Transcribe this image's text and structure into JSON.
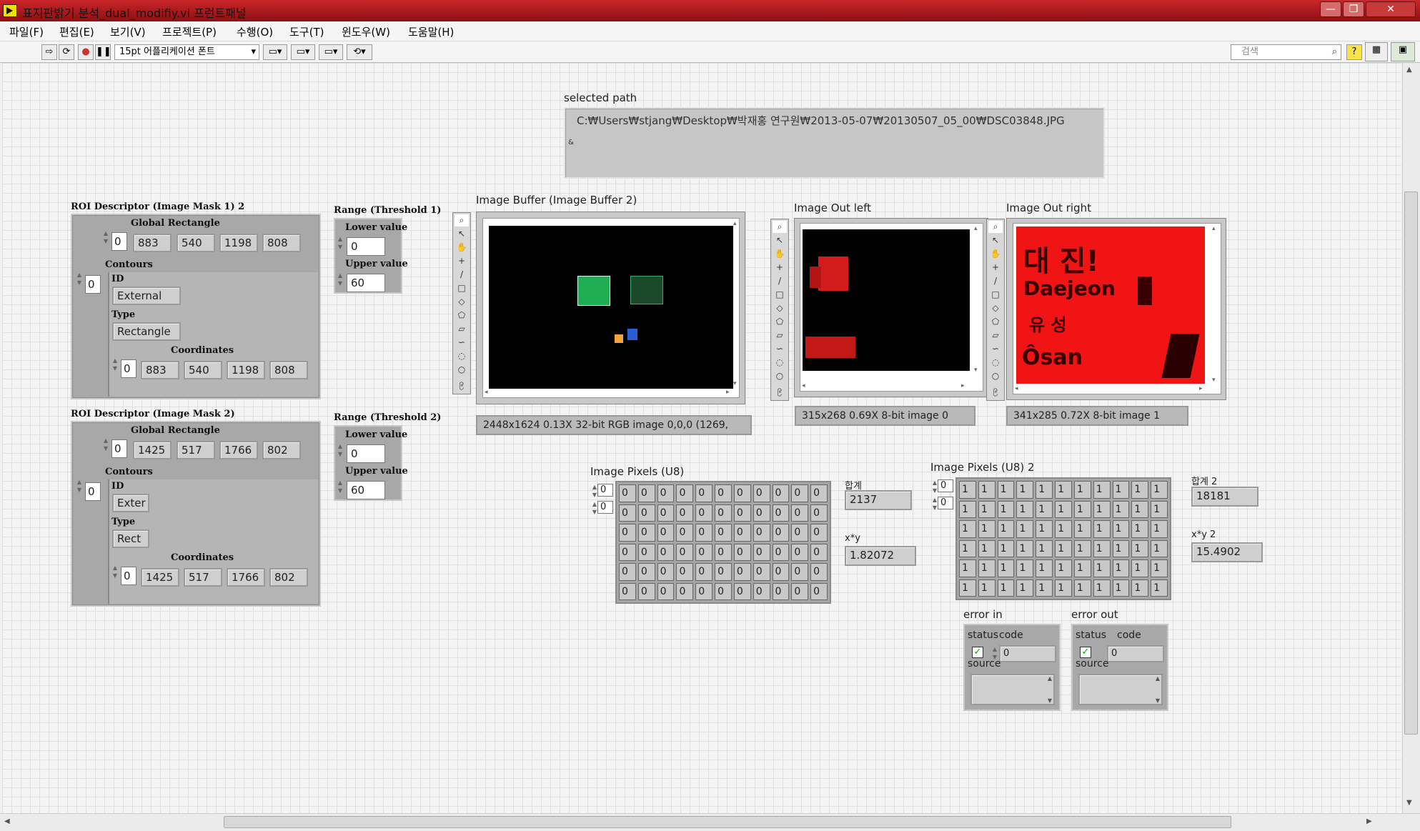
{
  "window": {
    "title": "표지판밝기 분석_dual_modifiy.vi 프런트패널"
  },
  "menu": [
    "파일(F)",
    "편집(E)",
    "보기(V)",
    "프로젝트(P)",
    "수행(O)",
    "도구(T)",
    "윈도우(W)",
    "도움말(H)"
  ],
  "toolbar": {
    "font": "15pt 어플리케이션 폰트",
    "search_placeholder": "검색"
  },
  "path": {
    "label": "selected path",
    "value": "C:₩Users₩stjang₩Desktop₩박재홍 연구원₩2013-05-07₩20130507_05_00₩DSC03848.JPG"
  },
  "roi1": {
    "label": "ROI Descriptor (Image Mask 1) 2",
    "global_label": "Global Rectangle",
    "gr_index": "0",
    "gr": [
      "883",
      "540",
      "1198",
      "808"
    ],
    "contours_label": "Contours",
    "contour_index": "0",
    "id_label": "ID",
    "id": "External",
    "type_label": "Type",
    "type": "Rectangle",
    "coords_label": "Coordinates",
    "coord_index": "0",
    "coords": [
      "883",
      "540",
      "1198",
      "808"
    ]
  },
  "roi2": {
    "label": "ROI Descriptor (Image Mask 2)",
    "global_label": "Global Rectangle",
    "gr_index": "0",
    "gr": [
      "1425",
      "517",
      "1766",
      "802"
    ],
    "contours_label": "Contours",
    "contour_index": "0",
    "id_label": "ID",
    "id": "Exter",
    "type_label": "Type",
    "type": "Rect",
    "coords_label": "Coordinates",
    "coord_index": "0",
    "coords": [
      "1425",
      "517",
      "1766",
      "802"
    ]
  },
  "range1": {
    "label": "Range (Threshold 1)",
    "lower_label": "Lower value",
    "lower": "0",
    "upper_label": "Upper value",
    "upper": "60"
  },
  "range2": {
    "label": "Range (Threshold 2)",
    "lower_label": "Lower value",
    "lower": "0",
    "upper_label": "Upper value",
    "upper": "60"
  },
  "buffer": {
    "label": "Image Buffer (Image Buffer 2)",
    "info": "2448x1624 0.13X 32-bit RGB image 0,0,0     (1269,"
  },
  "out_left": {
    "label": "Image Out left",
    "info": "315x268 0.69X 8-bit image 0"
  },
  "out_right": {
    "label": "Image Out right",
    "info": "341x285 0.72X 8-bit image 1"
  },
  "pixels1": {
    "label": "Image Pixels (U8)",
    "idx": [
      "0",
      "0"
    ],
    "value": "0",
    "rows": 6,
    "cols": 11
  },
  "pixels2": {
    "label": "Image Pixels (U8) 2",
    "idx": [
      "0",
      "0"
    ],
    "value": "1",
    "rows": 6,
    "cols": 11
  },
  "sum1": {
    "label": "합계",
    "value": "2137"
  },
  "xy1": {
    "label": "x*y",
    "value": "1.82072"
  },
  "sum2": {
    "label": "합계 2",
    "value": "18181"
  },
  "xy2": {
    "label": "x*y 2",
    "value": "15.4902"
  },
  "error_in": {
    "label": "error in",
    "status": "status",
    "code_label": "code",
    "code": "0",
    "source": "source"
  },
  "error_out": {
    "label": "error out",
    "status": "status",
    "code_label": "code",
    "code": "0",
    "source": "source"
  },
  "sign_text": [
    "대 진!",
    "Daejeon",
    "유 성",
    "Ôsan"
  ]
}
